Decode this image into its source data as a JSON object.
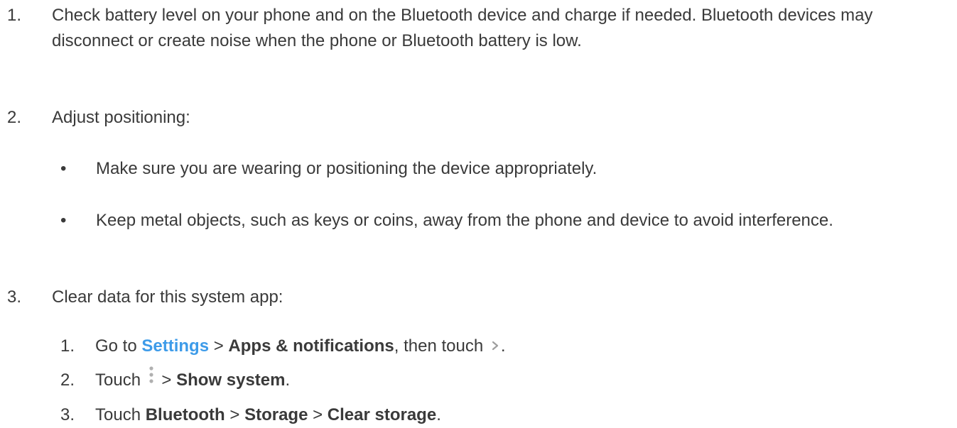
{
  "steps": [
    {
      "num": "1.",
      "text": "Check battery level on your phone and on the Bluetooth device and charge if needed. Bluetooth devices may disconnect or create noise when the phone or Bluetooth battery is low."
    },
    {
      "num": "2.",
      "text": "Adjust positioning:",
      "bullets": [
        {
          "mark": "•",
          "text": "Make sure you are wearing or positioning the device appropriately."
        },
        {
          "mark": "•",
          "text": "Keep metal objects, such as keys or coins, away from the phone and device to avoid interference."
        }
      ]
    },
    {
      "num": "3.",
      "text": "Clear data for this system app:",
      "substeps": [
        {
          "num": "1.",
          "pre": "Go to ",
          "link": "Settings",
          "sep1": " > ",
          "bold1": "Apps & notifications",
          "post": ", then touch ",
          "icon": "chevron-right-icon",
          "end": "."
        },
        {
          "num": "2.",
          "pre": "Touch ",
          "icon": "more-vert-icon",
          "sep1": " > ",
          "bold1": "Show system",
          "end": "."
        },
        {
          "num": "3.",
          "pre": "Touch ",
          "bold1": "Bluetooth",
          "sep1": " > ",
          "bold2": "Storage",
          "sep2": " > ",
          "bold3": "Clear storage",
          "end": "."
        }
      ]
    }
  ],
  "colors": {
    "text": "#3a3a3a",
    "link": "#3d9be9",
    "icon": "#9e9e9e"
  }
}
